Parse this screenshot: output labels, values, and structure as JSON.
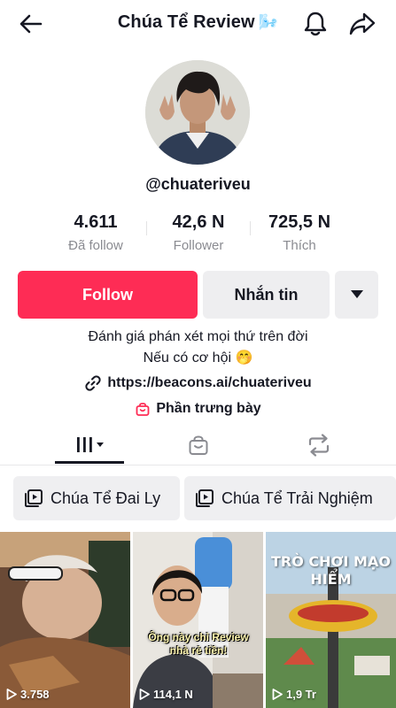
{
  "header": {
    "title": "Chúa Tể Review",
    "title_emoji": "🌬️",
    "icons": [
      "arrow-left-icon",
      "bell-icon",
      "share-icon"
    ]
  },
  "profile": {
    "username": "@chuateriveu",
    "stats": [
      {
        "value": "4.611",
        "label": "Đã follow"
      },
      {
        "value": "42,6 N",
        "label": "Follower"
      },
      {
        "value": "725,5 N",
        "label": "Thích"
      }
    ],
    "follow_label": "Follow",
    "message_label": "Nhắn tin",
    "bio_line1": "Đánh giá phán xét mọi thứ trên đời",
    "bio_line2": "Nếu có cơ hội 🤭",
    "link": "https://beacons.ai/chuateriveu",
    "showcase_label": "Phần trưng bày"
  },
  "tabs": [
    "videos-grid",
    "shop",
    "reposts"
  ],
  "playlists": [
    {
      "label": "Chúa Tể Đai Ly"
    },
    {
      "label": "Chúa Tể Trải Nghiệm"
    }
  ],
  "videos": [
    {
      "views": "3.758",
      "caption": ""
    },
    {
      "views": "114,1 N",
      "caption": "Ông này chỉ Review nhà rẻ tiền!"
    },
    {
      "views": "1,9 Tr",
      "caption": "TRÒ CHƠI MẠO HIỂM"
    }
  ],
  "colors": {
    "follow_bg": "#fe2c55",
    "secondary_bg": "#eeeef0",
    "text_primary": "#161823",
    "text_secondary": "#8a8b91",
    "shop_icon": "#fe2c55"
  }
}
